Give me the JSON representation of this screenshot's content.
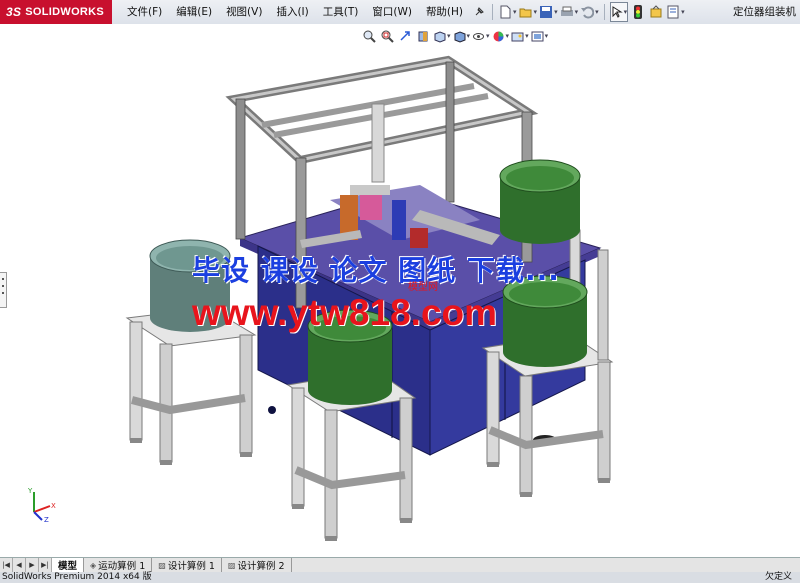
{
  "app": {
    "logo_ds": "3S",
    "logo_text": "SOLIDWORKS",
    "document_title": "定位器组装机"
  },
  "menu": {
    "items": [
      "文件(F)",
      "编辑(E)",
      "视图(V)",
      "插入(I)",
      "工具(T)",
      "窗口(W)",
      "帮助(H)"
    ]
  },
  "toolbar": {
    "icons": [
      "pushpin-icon",
      "new-document-icon",
      "open-folder-icon",
      "save-icon",
      "print-icon",
      "undo-icon",
      "select-arrow-icon",
      "rebuild-icon",
      "options-icon",
      "file-properties-icon"
    ]
  },
  "heads_up": {
    "icons": [
      "zoom-to-fit-icon",
      "zoom-area-icon",
      "previous-view-icon",
      "section-view-icon",
      "view-orientation-icon",
      "display-style-icon",
      "hide-show-icon",
      "edit-appearance-icon",
      "apply-scene-icon",
      "view-settings-icon"
    ]
  },
  "watermark": {
    "line1": "毕设 课设 论文 图纸 下载...",
    "line2": "www.ytw818.com",
    "logo": "模型网"
  },
  "triad": {
    "x": "X",
    "y": "Y",
    "z": "Z"
  },
  "tabs": {
    "items": [
      {
        "label": "模型",
        "active": true
      },
      {
        "label": "运动算例 1",
        "active": false
      },
      {
        "label": "设计算例 1",
        "active": false
      },
      {
        "label": "设计算例 2",
        "active": false
      }
    ]
  },
  "status": {
    "left": "SolidWorks Premium 2014 x64 版",
    "right": "欠定义"
  },
  "colors": {
    "frame": "#8d8d8d",
    "table_purple": "#5a4fa8",
    "cabinet_blue": "#2b2f8a",
    "bowl_green": "#3f8a3a",
    "bowl_teal": "#6f9790",
    "stand_gray": "#d9d9d9",
    "watermark_blue": "#1b3fe0",
    "watermark_red": "#e8141c"
  }
}
